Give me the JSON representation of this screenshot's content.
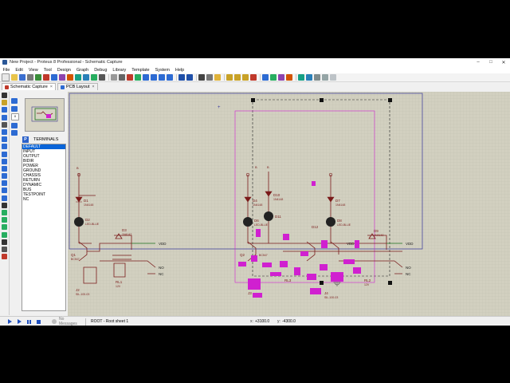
{
  "window": {
    "title": "New Project - Proteus 8 Professional - Schematic Capture",
    "controls": {
      "minimize": "–",
      "maximize": "□",
      "close": "✕"
    }
  },
  "menu": [
    "File",
    "Edit",
    "View",
    "Tool",
    "Design",
    "Graph",
    "Debug",
    "Library",
    "Template",
    "System",
    "Help"
  ],
  "tabs": [
    {
      "label": "Schematic Capture",
      "close": "×",
      "active": true
    },
    {
      "label": "PCB Layout",
      "close": "×",
      "active": false
    }
  ],
  "panel": {
    "button_label": "P",
    "header": "TERMINALS",
    "items": [
      "DEFAULT",
      "INPUT",
      "OUTPUT",
      "BIDIR",
      "POWER",
      "GROUND",
      "CHASSIS",
      "RETURN",
      "DYNAMIC",
      "BUS",
      "TESTPOINT",
      "NC"
    ],
    "selected": "DEFAULT",
    "angle": "0"
  },
  "status": {
    "messages": "No Messages",
    "sheet": "ROOT - Root sheet 1",
    "x_label": "x:",
    "x_value": "+3100.0",
    "y_label": "y:",
    "y_value": "-4300.0"
  },
  "schematic": {
    "left_circuit": {
      "led_label": "D1",
      "led_part": "1N4148",
      "led2_label": "D2",
      "led2_part": "LED-BLUE",
      "diode3_label": "D3",
      "diode3_part": "1N4142",
      "transistor_label": "Q1",
      "transistor_part": "BC547",
      "relay_label": "RL1",
      "relay_part": "12V",
      "connector_label": "J2",
      "connector_part": "SIL-100-03",
      "vdd_label": "VDD",
      "no_label": "NO",
      "nc_label": "NC",
      "top_marker": "B"
    },
    "right_circuit": {
      "d4_label": "D4",
      "d4_part": "1N4148",
      "d10_label": "D10",
      "d10_part": "1N4148",
      "d7_label": "D7",
      "d7_part": "1N4148",
      "d6_label": "D6",
      "d11_label": "D11",
      "d12_label": "D12",
      "d8_label": "D8",
      "d8_part": "LED-BLUE",
      "d6_part": "LED-BLUE",
      "d9_label": "D9",
      "d9_part": "1N4142",
      "q2_label": "Q2",
      "q2_part": "BC547",
      "rl3_label": "RL3",
      "rl2_label": "RL2",
      "rl2_part": "12V",
      "j3_label": "J3",
      "j4_label": "J4",
      "j4_part": "SIL-100-03",
      "vdd_label": "VDD",
      "vdd2_label": "VDD",
      "no_label": "NO",
      "nc_label": "NC",
      "top_marker": "B",
      "top_marker2": "B"
    }
  }
}
